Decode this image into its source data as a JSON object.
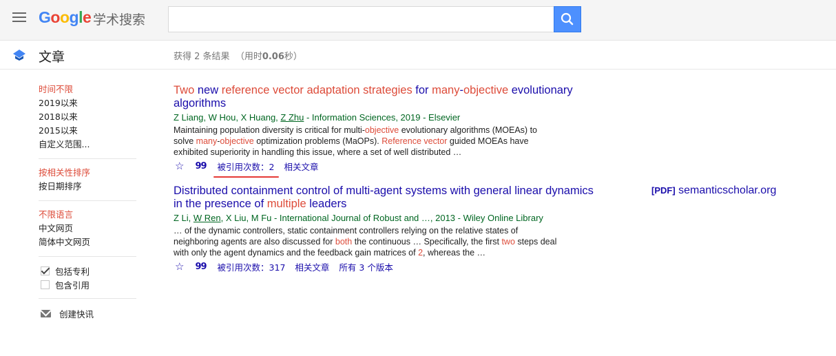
{
  "header": {
    "logo": "Google",
    "logo_sub": "学术搜索",
    "search_value": "",
    "search_placeholder": ""
  },
  "subbar": {
    "section_label": "文章",
    "result_count_prefix": "获得 2 条结果",
    "result_count_time": "（用时",
    "result_count_time_value": "0.06",
    "result_count_time_suffix": "秒）"
  },
  "sidebar": {
    "time_filters": [
      "时间不限",
      "2019以来",
      "2018以来",
      "2015以来",
      "自定义范围..."
    ],
    "sort_options": [
      "按相关性排序",
      "按日期排序"
    ],
    "language_options": [
      "不限语言",
      "中文网页",
      "简体中文网页"
    ],
    "checkboxes": [
      {
        "label": "包括专利",
        "checked": true
      },
      {
        "label": "包含引用",
        "checked": false
      }
    ],
    "create_alert": "创建快讯"
  },
  "results": [
    {
      "title_parts": [
        {
          "t": "Two",
          "hl": true
        },
        {
          "t": " new ",
          "hl": false
        },
        {
          "t": "reference vector adaptation strategies",
          "hl": true
        },
        {
          "t": " for ",
          "hl": false
        },
        {
          "t": "many",
          "hl": true
        },
        {
          "t": "-",
          "hl": false
        },
        {
          "t": "objective",
          "hl": true
        },
        {
          "t": " evolutionary algorithms",
          "hl": false
        }
      ],
      "authors": [
        "Z Liang",
        "W Hou",
        "X Huang",
        "Z Zhu"
      ],
      "underlined_author": "Z Zhu",
      "source": " - Information Sciences, 2019 - Elsevier",
      "snippet_parts": [
        {
          "t": "Maintaining population diversity is critical for multi-",
          "hl": false
        },
        {
          "t": "objective",
          "hl": true
        },
        {
          "t": " evolutionary algorithms (MOEAs) to solve ",
          "hl": false
        },
        {
          "t": "many",
          "hl": true
        },
        {
          "t": "-",
          "hl": false
        },
        {
          "t": "objective",
          "hl": true
        },
        {
          "t": " optimization problems (MaOPs). ",
          "hl": false
        },
        {
          "t": "Reference vector",
          "hl": true
        },
        {
          "t": " guided MOEAs have exhibited superiority in handling this issue, where a set of well distributed …",
          "hl": false
        }
      ],
      "cited_by": "被引用次数：2",
      "related": "相关文章",
      "versions": ""
    },
    {
      "title_parts": [
        {
          "t": "Distributed containment control of multi-agent systems with general linear dynamics in the presence of ",
          "hl": false
        },
        {
          "t": "multiple",
          "hl": true
        },
        {
          "t": " leaders",
          "hl": false
        }
      ],
      "authors": [
        "Z Li",
        "W Ren",
        "X Liu",
        "M Fu"
      ],
      "underlined_author": "W Ren",
      "source": " - International Journal of Robust and …, 2013 - Wiley Online Library",
      "snippet_parts": [
        {
          "t": "… of the dynamic controllers, static containment controllers relying on the relative states of neighboring agents are also discussed for ",
          "hl": false
        },
        {
          "t": "both",
          "hl": true
        },
        {
          "t": " the continuous … Specifically, the first ",
          "hl": false
        },
        {
          "t": "two",
          "hl": true
        },
        {
          "t": " steps deal with only the agent dynamics and the feedback gain matrices of ",
          "hl": false
        },
        {
          "t": "2",
          "hl": true
        },
        {
          "t": ", whereas the …",
          "hl": false
        }
      ],
      "cited_by": "被引用次数：317",
      "related": "相关文章",
      "versions": "所有 3 个版本"
    }
  ],
  "pdf_link": {
    "tag": "[PDF]",
    "domain": "semanticscholar.org"
  },
  "colors": {
    "link": "#1a0dab",
    "highlight": "#dd4b39",
    "green": "#006621",
    "search_button": "#4d90fe"
  }
}
